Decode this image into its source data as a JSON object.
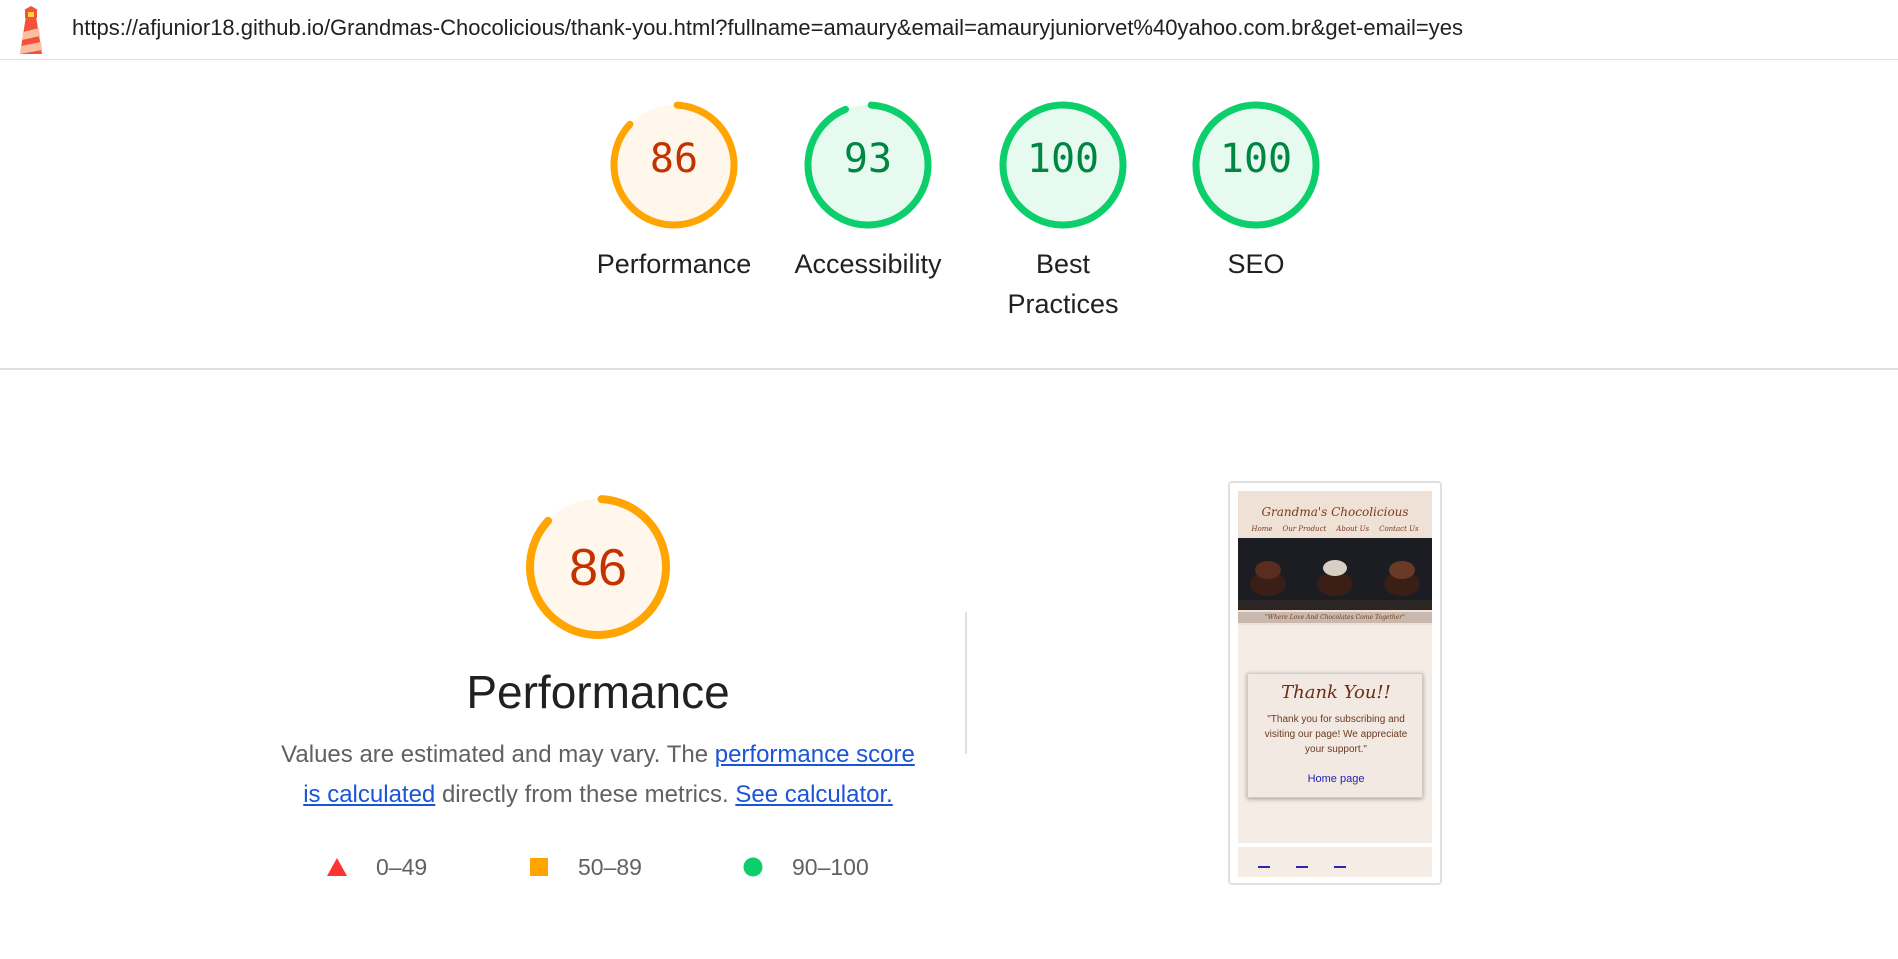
{
  "url": "https://afjunior18.github.io/Grandmas-Chocolicious/thank-you.html?fullname=amaury&email=amauryjuniorvet%40yahoo.com.br&get-email=yes",
  "gauges": [
    {
      "score": "86",
      "label": "Performance",
      "fraction": 0.86,
      "color": "#ffa400",
      "text_color": "#c33300",
      "bg": "#fff6ec"
    },
    {
      "score": "93",
      "label": "Accessibility",
      "fraction": 0.93,
      "color": "#0cce6b",
      "text_color": "#018642",
      "bg": "#e6faf0"
    },
    {
      "score": "100",
      "label": "Best Practices",
      "fraction": 1.0,
      "color": "#0cce6b",
      "text_color": "#018642",
      "bg": "#e6faf0"
    },
    {
      "score": "100",
      "label": "SEO",
      "fraction": 1.0,
      "color": "#0cce6b",
      "text_color": "#018642",
      "bg": "#e6faf0"
    }
  ],
  "performance": {
    "score": "86",
    "fraction": 0.86,
    "title": "Performance",
    "desc_prefix": "Values are estimated and may vary. The ",
    "desc_link1": "performance score is calculated",
    "desc_middle": " directly from these metrics. ",
    "desc_link2": "See calculator."
  },
  "legend": [
    {
      "range": "0–49",
      "shape": "triangle",
      "color": "#ff3333"
    },
    {
      "range": "50–89",
      "shape": "square",
      "color": "#ffa400"
    },
    {
      "range": "90–100",
      "shape": "circle",
      "color": "#0cce6b"
    }
  ],
  "thumbnail": {
    "site_title": "Grandma's Chocolicious",
    "nav": [
      "Home",
      "Our Product",
      "About Us",
      "Contact Us"
    ],
    "tagline": "\"Where Love And Chocolates Come Together\"",
    "card_title": "Thank You!!",
    "card_text": "\"Thank you for subscribing and visiting our page! We appreciate your support.\"",
    "card_link": "Home page"
  }
}
